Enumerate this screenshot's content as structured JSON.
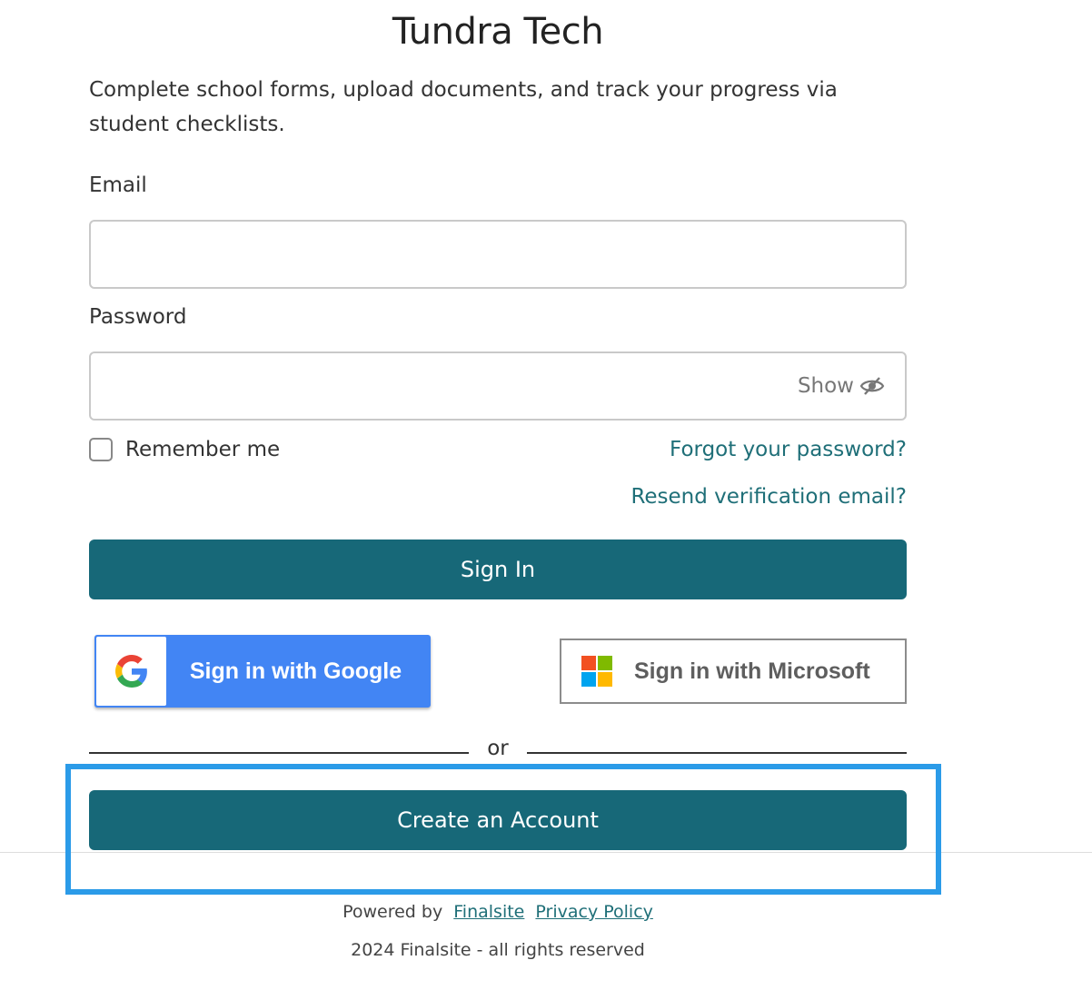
{
  "header": {
    "title": "Tundra Tech",
    "subtitle": "Complete school forms, upload documents, and track your progress via student checklists."
  },
  "form": {
    "email_label": "Email",
    "email_value": "",
    "password_label": "Password",
    "password_value": "",
    "show_label": "Show",
    "remember_label": "Remember me",
    "remember_checked": false,
    "forgot_link": "Forgot your password?",
    "resend_link": "Resend verification email?",
    "signin_label": "Sign In"
  },
  "sso": {
    "google_label": "Sign in with Google",
    "microsoft_label": "Sign in with Microsoft"
  },
  "divider": {
    "text": "or"
  },
  "create_account_label": "Create an Account",
  "footer": {
    "powered_by": "Powered by",
    "finalsite_link": "Finalsite",
    "privacy_link": "Privacy Policy",
    "copyright": "2024 Finalsite - all rights reserved"
  },
  "colors": {
    "primary": "#176878",
    "link": "#1f6f78",
    "google_blue": "#4285f4",
    "highlight": "#2b9be8"
  }
}
